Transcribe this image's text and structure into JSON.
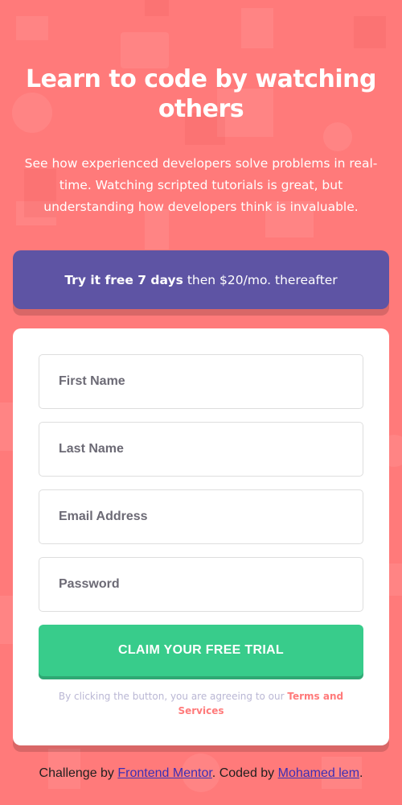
{
  "hero": {
    "title": "Learn to code by watching others",
    "description": "See how experienced developers solve problems in real-time. Watching scripted tutorials is great, but understanding how developers think is invaluable."
  },
  "trial_banner": {
    "bold": "Try it free 7 days",
    "rest": "then $20/mo. thereafter"
  },
  "form": {
    "fields": [
      {
        "placeholder": "First Name"
      },
      {
        "placeholder": "Last Name"
      },
      {
        "placeholder": "Email Address"
      },
      {
        "placeholder": "Password"
      }
    ],
    "submit_label": "CLAIM YOUR FREE TRIAL",
    "legal_prefix": "By clicking the button, you are agreeing to our",
    "legal_link": "Terms and Services"
  },
  "footer": {
    "prefix": "Challenge by",
    "link1": "Frontend Mentor",
    "middle": ". Coded by",
    "link2": "Mohamed lem",
    "suffix": "."
  },
  "colors": {
    "background": "#ff7a7a",
    "banner": "#5e54a4",
    "button": "#38cc8b",
    "terms": "#ff7a7a"
  }
}
